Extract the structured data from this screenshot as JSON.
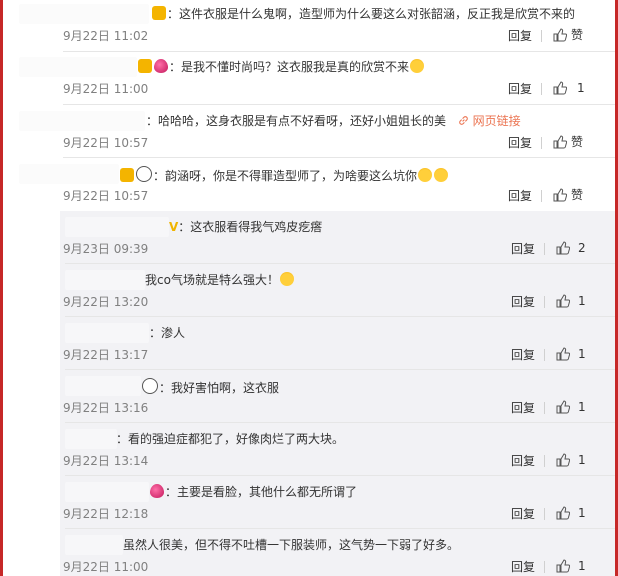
{
  "comments": [
    {
      "text": "：这件衣服是什么鬼啊，造型师为什么要这么对张韶涵，反正我是欣赏不来的",
      "time": "9月22日 11:02",
      "reply": "回复",
      "likes": "赞"
    },
    {
      "text": "：是我不懂时尚吗？这衣服我是真的欣赏不来",
      "time": "9月22日 11:00",
      "reply": "回复",
      "likes": "1"
    },
    {
      "text": "：哈哈哈，这身衣服是有点不好看呀，还好小姐姐长的美",
      "link": "网页链接",
      "time": "9月22日 10:57",
      "reply": "回复",
      "likes": "赞"
    },
    {
      "text": "：韵涵呀，你是不得罪造型师了，为啥要这么坑你",
      "time": "9月22日 10:57",
      "reply": "回复",
      "likes": "赞"
    },
    {
      "text": "：这衣服看得我气鸡皮疙瘩",
      "time": "9月23日 09:39",
      "reply": "回复",
      "likes": "2"
    },
    {
      "text": "我co气场就是特么强大！",
      "time": "9月22日 13:20",
      "reply": "回复",
      "likes": "1"
    },
    {
      "text": "：渗人",
      "time": "9月22日 13:17",
      "reply": "回复",
      "likes": "1"
    },
    {
      "text": "：我好害怕啊，这衣服",
      "time": "9月22日 13:16",
      "reply": "回复",
      "likes": "1"
    },
    {
      "text": "：看的强迫症都犯了，好像肉烂了两大块。",
      "time": "9月22日 13:14",
      "reply": "回复",
      "likes": "1"
    },
    {
      "text": "：主要是看脸，其他什么都无所谓了",
      "time": "9月22日 12:18",
      "reply": "回复",
      "likes": "1"
    },
    {
      "text": "虽然人很美，但不得不吐槽一下服装师，这气势一下弱了好多。",
      "time": "9月22日 11:00",
      "reply": "回复",
      "likes": "1"
    }
  ]
}
